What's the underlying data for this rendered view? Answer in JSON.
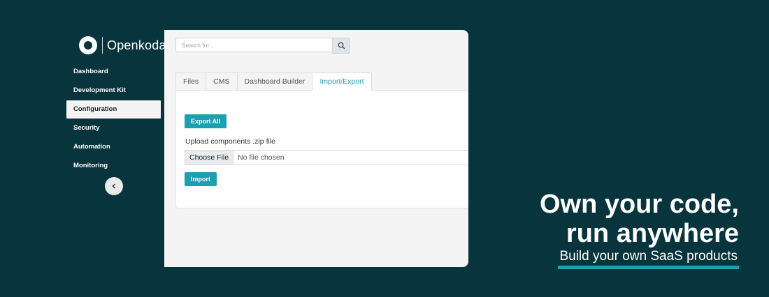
{
  "brand": {
    "name": "Openkoda"
  },
  "sidebar": {
    "items": [
      {
        "label": "Dashboard"
      },
      {
        "label": "Development Kit"
      },
      {
        "label": "Configuration"
      },
      {
        "label": "Security"
      },
      {
        "label": "Automation"
      },
      {
        "label": "Monitoring"
      }
    ],
    "active_item": "Configuration"
  },
  "search": {
    "placeholder": "Search for..."
  },
  "tabs": [
    {
      "label": "Files"
    },
    {
      "label": "CMS"
    },
    {
      "label": "Dashboard Builder"
    },
    {
      "label": "Import/Export"
    }
  ],
  "active_tab": "Import/Export",
  "panel": {
    "export_label": "Export All",
    "upload_label": "Upload components .zip file",
    "choose_file_label": "Choose File",
    "file_status": "No file chosen",
    "import_label": "Import"
  },
  "tagline": {
    "line1": "Own your code,",
    "line2": "run anywhere",
    "sub": "Build your own SaaS products"
  },
  "colors": {
    "background": "#08343d",
    "accent": "#1aa0b1",
    "active_tab_text": "#2aa3ad"
  },
  "icons": {
    "search": "search-icon",
    "collapse": "chevron-left-icon",
    "logo": "logo-icon"
  }
}
